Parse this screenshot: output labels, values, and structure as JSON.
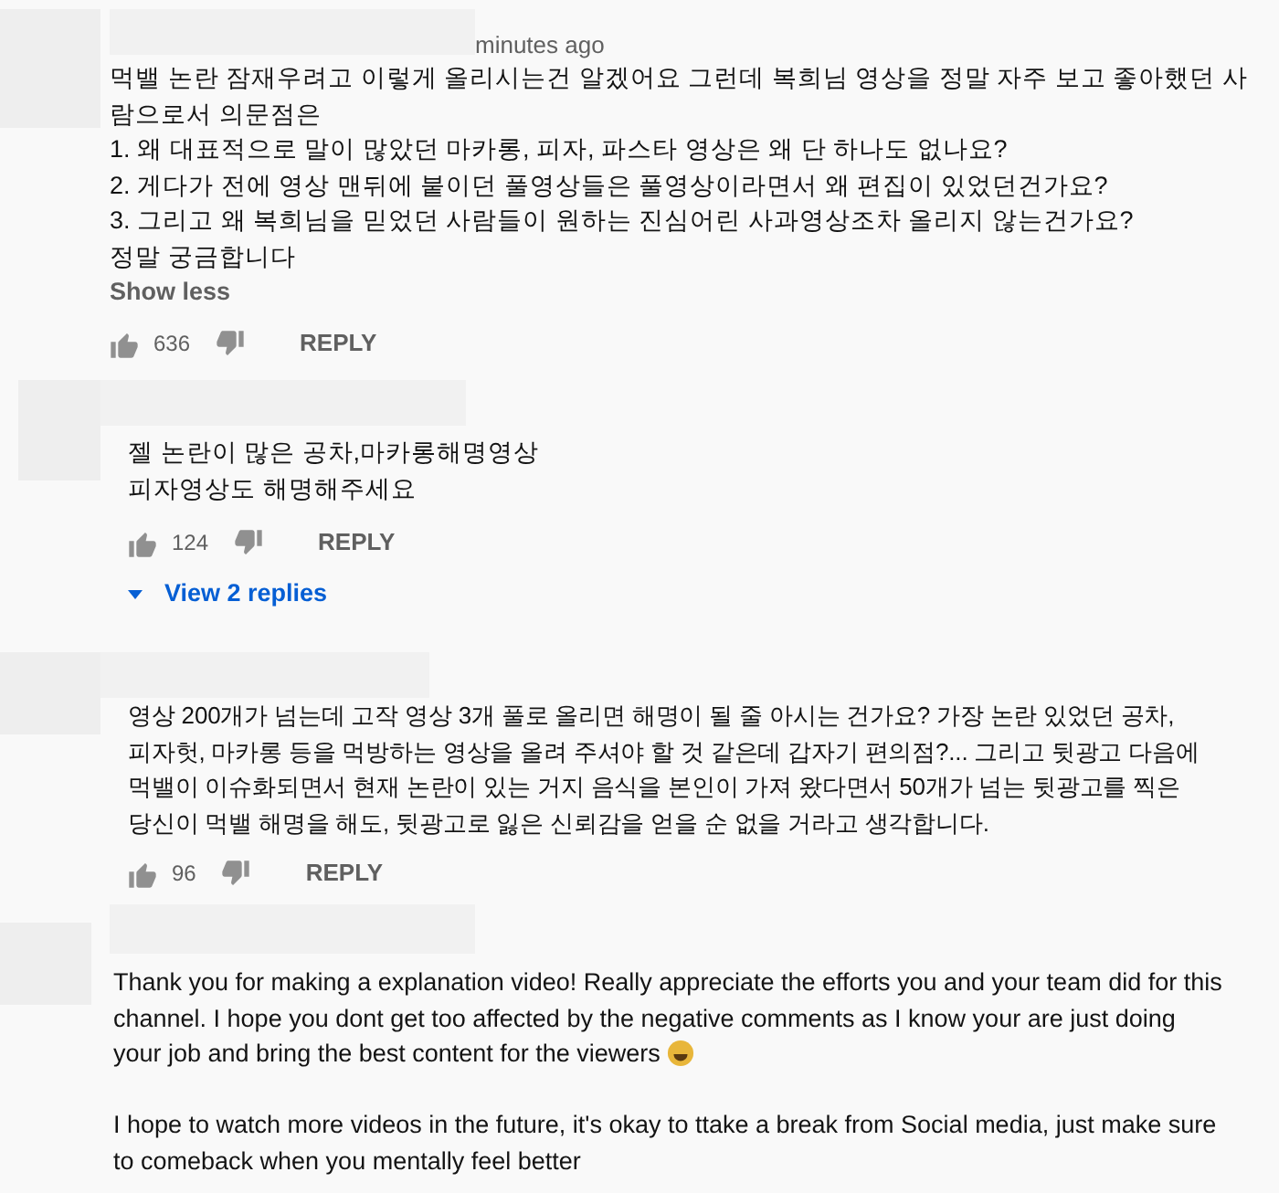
{
  "comments": [
    {
      "time": "minutes ago",
      "paragraphs": [
        {
          "lines": [
            "먹밸 논란 잠재우려고 이렇게 올리시는건 알겠어요 그런데 복희님 영상을 정말 자주 보고 좋아했던 사",
            "람으로서 의문점은",
            "1. 왜 대표적으로 말이 많았던 마카롱, 피자, 파스타 영상은 왜 단 하나도 없나요?",
            "2. 게다가 전에 영상 맨뒤에 붙이던 풀영상들은 풀영상이라면서 왜 편집이 있었던건가요?",
            "3. 그리고 왜 복희님을 믿었던 사람들이 원하는 진심어린 사과영상조차 올리지 않는건가요?",
            "정말 궁금합니다"
          ]
        }
      ],
      "toggle": "Show less",
      "likes": "636",
      "reply": "REPLY"
    },
    {
      "paragraphs": [
        {
          "lines": [
            "젤 논란이 많은 공차,마카롱해명영상",
            "피자영상도 해명해주세요"
          ]
        }
      ],
      "likes": "124",
      "reply": "REPLY",
      "replies": "View 2 replies"
    },
    {
      "paragraphs": [
        {
          "lines": [
            "영상 200개가 넘는데 고작 영상 3개 풀로 올리면 해명이 될 줄 아시는 건가요? 가장 논란 있었던 공차,",
            "피자헛, 마카롱 등을 먹방하는 영상을 올려 주셔야 할 것 같은데 갑자기 편의점?... 그리고 뒷광고 다음에",
            "먹밸이 이슈화되면서 현재 논란이 있는 거지 음식을 본인이 가져 왔다면서 50개가 넘는 뒷광고를 찍은",
            "당신이 먹밸 해명을 해도, 뒷광고로 잃은 신뢰감을 얻을 순 없을 거라고 생각합니다."
          ]
        }
      ],
      "likes": "96",
      "reply": "REPLY"
    },
    {
      "paragraphs": [
        {
          "lines": [
            "Thank you for making a explanation video! Really appreciate the efforts you and your team did for this",
            "channel. I hope you dont get too affected by the negative comments as I know your are just doing",
            "your job and bring the best content for the viewers"
          ],
          "ends_with_emoji": true
        },
        {
          "lines": [
            "I hope to watch more videos in the future, it's okay to ttake a break from Social media, just make sure",
            "to comeback when you mentally feel better"
          ]
        }
      ]
    }
  ]
}
